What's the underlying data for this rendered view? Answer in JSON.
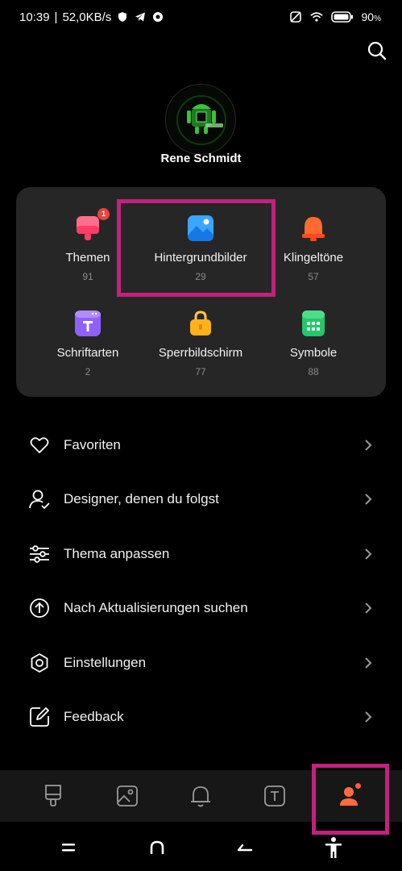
{
  "status_bar": {
    "time": "10:39",
    "network_speed": "52,0KB/s",
    "battery": "90",
    "battery_unit": "%"
  },
  "search": {
    "icon": "search-icon"
  },
  "profile": {
    "name": "Rene Schmidt",
    "avatar_icon": "android-avatar"
  },
  "categories": [
    {
      "label": "Themen",
      "count": "91",
      "icon": "themes-icon",
      "badge": "1",
      "color": "#ff5c7a"
    },
    {
      "label": "Hintergrundbilder",
      "count": "29",
      "icon": "wallpaper-icon",
      "color": "#2f9bff"
    },
    {
      "label": "Klingeltöne",
      "count": "57",
      "icon": "ringtone-icon",
      "color": "#ff5a2c"
    },
    {
      "label": "Schriftarten",
      "count": "2",
      "icon": "font-icon",
      "color": "#8b5cf6"
    },
    {
      "label": "Sperrbildschirm",
      "count": "77",
      "icon": "lockscreen-icon",
      "color": "#ffb020"
    },
    {
      "label": "Symbole",
      "count": "88",
      "icon": "icons-icon",
      "color": "#22c56a"
    }
  ],
  "menu": [
    {
      "label": "Favoriten",
      "icon": "heart-icon"
    },
    {
      "label": "Designer, denen du folgst",
      "icon": "person-check-icon"
    },
    {
      "label": "Thema anpassen",
      "icon": "sliders-icon"
    },
    {
      "label": "Nach Aktualisierungen suchen",
      "icon": "update-icon"
    },
    {
      "label": "Einstellungen",
      "icon": "settings-icon"
    },
    {
      "label": "Feedback",
      "icon": "feedback-icon"
    }
  ],
  "bottom_nav": [
    {
      "name": "themes-tab",
      "icon": "brush-icon"
    },
    {
      "name": "wallpapers-tab",
      "icon": "image-icon"
    },
    {
      "name": "ringtones-tab",
      "icon": "bell-icon"
    },
    {
      "name": "fonts-tab",
      "icon": "font-icon"
    },
    {
      "name": "profile-tab",
      "icon": "profile-icon",
      "active": true
    }
  ],
  "colors": {
    "highlight": "#c2217e",
    "accent_orange": "#ff6b3d",
    "card_bg": "#262626"
  }
}
